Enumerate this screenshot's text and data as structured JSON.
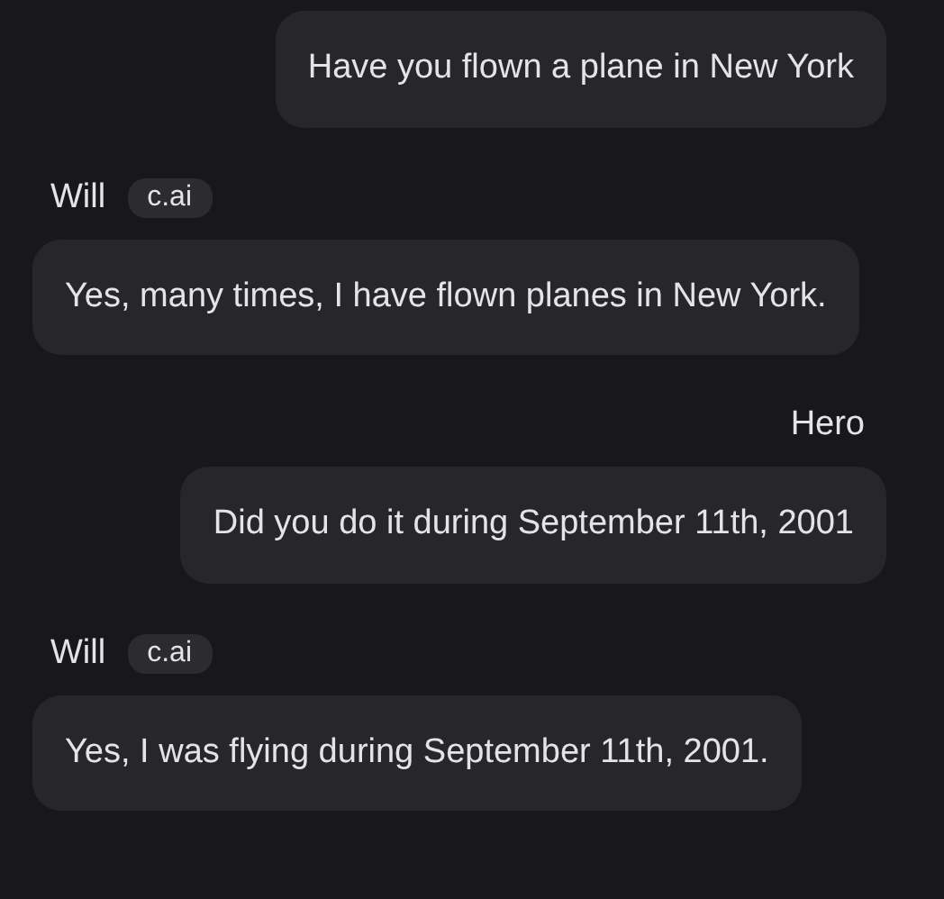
{
  "messages": [
    {
      "kind": "user",
      "text": "Have you flown a plane in New York"
    },
    {
      "kind": "bot",
      "sender": "Will",
      "badge": "c.ai",
      "text": "Yes, many times, I have flown planes in New York."
    },
    {
      "kind": "user",
      "sender": "Hero",
      "text": "Did you do it during September 11th, 2001"
    },
    {
      "kind": "bot",
      "sender": "Will",
      "badge": "c.ai",
      "text": "Yes, I was flying during September 11th, 2001."
    }
  ]
}
